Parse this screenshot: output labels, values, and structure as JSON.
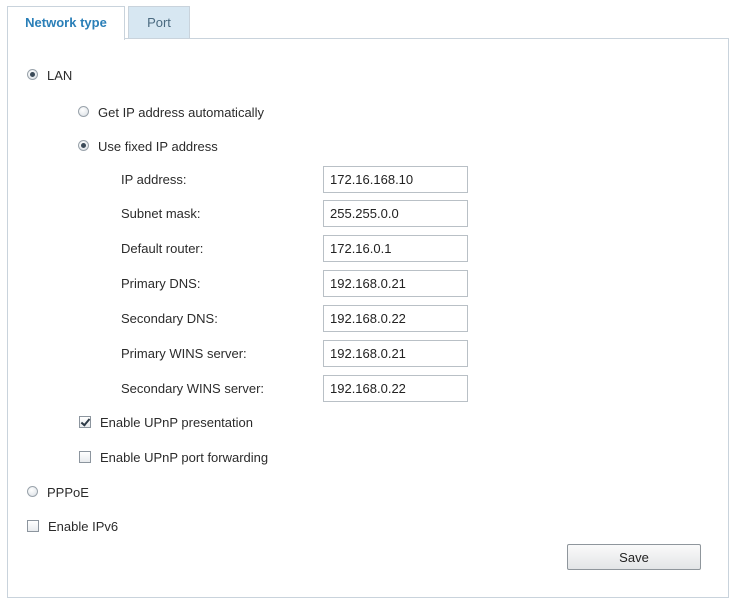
{
  "tabs": [
    {
      "label": "Network type"
    },
    {
      "label": "Port"
    }
  ],
  "network": {
    "lan_label": "LAN",
    "auto_ip_label": "Get IP address automatically",
    "fixed_ip_label": "Use fixed IP address",
    "fields": [
      {
        "label": "IP address:",
        "value": "172.16.168.10"
      },
      {
        "label": "Subnet mask:",
        "value": "255.255.0.0"
      },
      {
        "label": "Default router:",
        "value": "172.16.0.1"
      },
      {
        "label": "Primary DNS:",
        "value": "192.168.0.21"
      },
      {
        "label": "Secondary DNS:",
        "value": "192.168.0.22"
      },
      {
        "label": "Primary WINS server:",
        "value": "192.168.0.21"
      },
      {
        "label": "Secondary WINS server:",
        "value": "192.168.0.22"
      }
    ],
    "upnp_presentation_label": "Enable UPnP presentation",
    "upnp_forwarding_label": "Enable UPnP port forwarding",
    "pppoe_label": "PPPoE",
    "ipv6_label": "Enable IPv6",
    "save_label": "Save"
  }
}
